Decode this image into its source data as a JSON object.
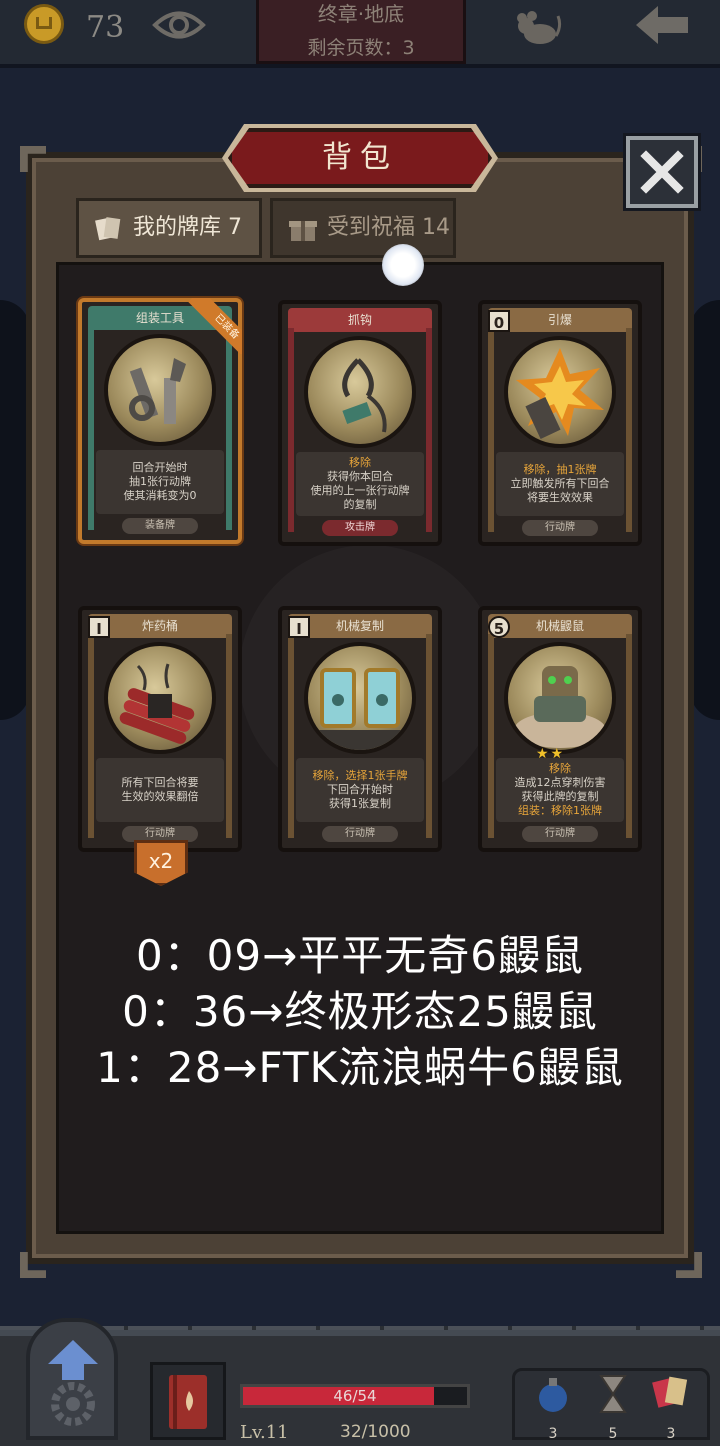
{
  "hud": {
    "coins": "73",
    "chapter_title": "终章·地底",
    "pages_left": "剩余页数：3"
  },
  "panel": {
    "title": "背包",
    "tabs": [
      {
        "label": "我的牌库 7",
        "active": true
      },
      {
        "label": "受到祝福 14",
        "active": false
      }
    ]
  },
  "cards": [
    {
      "name": "组装工具",
      "cost": "",
      "equipped_label": "已装备",
      "text_lines": [
        "回合开始时",
        "抽1张行动牌",
        "使其消耗变为0"
      ],
      "type": "装备牌",
      "header_color": "#3f7a6a",
      "frame_color": "#3f7a6a"
    },
    {
      "name": "抓钩",
      "cost": "",
      "keyword": "移除",
      "text_lines": [
        "获得你本回合",
        "使用的上一张行动牌",
        "的复制"
      ],
      "type": "攻击牌",
      "header_color": "#9c3a3a",
      "frame_color": "#7b2a2e"
    },
    {
      "name": "引爆",
      "cost": "0",
      "keyword": "移除，抽1张牌",
      "text_lines": [
        "立即触发所有下回合",
        "将要生效效果"
      ],
      "type": "行动牌",
      "header_color": "#8a6a44",
      "frame_color": "#6b5233"
    },
    {
      "name": "炸药桶",
      "cost": "I",
      "text_lines": [
        "所有下回合将要",
        "生效的效果翻倍"
      ],
      "type": "行动牌",
      "header_color": "#8a6a44",
      "frame_color": "#6b5233"
    },
    {
      "name": "机械复制",
      "cost": "I",
      "keyword": "移除，选择1张手牌",
      "text_lines": [
        "下回合开始时",
        "获得1张复制"
      ],
      "type": "行动牌",
      "header_color": "#8a6a44",
      "frame_color": "#6b5233"
    },
    {
      "name": "机械鼹鼠",
      "cost": "5",
      "stars": "★★",
      "keyword": "移除",
      "text_lines": [
        "造成12点穿刺伤害",
        "获得此牌的复制"
      ],
      "extra_line": "组装：移除1张牌",
      "type": "行动牌",
      "header_color": "#8a6a44",
      "frame_color": "#6b5233"
    }
  ],
  "multiplier": "x2",
  "captions": [
    "0：09→平平无奇6鼹鼠",
    "0：36→终极形态25鼹鼠",
    "1：28→FTK流浪蜗牛6鼹鼠"
  ],
  "bottom": {
    "hp_text": "46/54",
    "hp_current": 46,
    "hp_max": 54,
    "level": "Lv.11",
    "xp": "32/1000",
    "resources": [
      {
        "icon": "bomb-icon",
        "count": "3"
      },
      {
        "icon": "hourglass-icon",
        "count": "5"
      },
      {
        "icon": "cards-icon",
        "count": "3"
      }
    ]
  },
  "colors": {
    "accent_red": "#7a1a1c",
    "equip_orange": "#c27a2c",
    "hp_red": "#c8283a"
  }
}
